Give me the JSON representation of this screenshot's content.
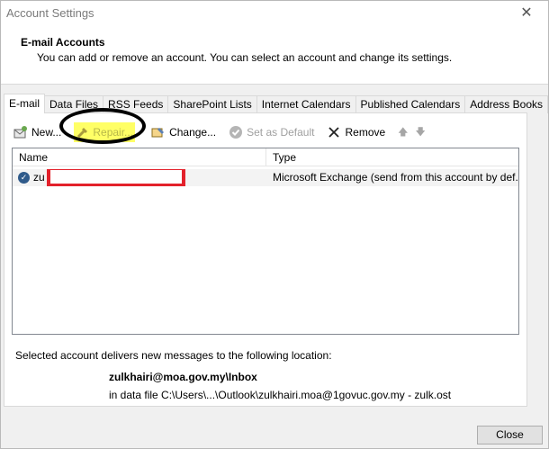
{
  "window": {
    "title": "Account Settings",
    "close_glyph": "✕"
  },
  "header": {
    "title": "E-mail Accounts",
    "subtitle": "You can add or remove an account. You can select an account and change its settings."
  },
  "tabs": [
    {
      "label": "E-mail",
      "active": true
    },
    {
      "label": "Data Files"
    },
    {
      "label": "RSS Feeds"
    },
    {
      "label": "SharePoint Lists"
    },
    {
      "label": "Internet Calendars"
    },
    {
      "label": "Published Calendars"
    },
    {
      "label": "Address Books"
    }
  ],
  "toolbar": {
    "new_label": "New...",
    "repair_label": "Repair...",
    "change_label": "Change...",
    "set_default_label": "Set as Default",
    "remove_label": "Remove",
    "up_glyph": "🡅",
    "down_glyph": "🡇",
    "highlight_color": "#ffff66",
    "annotation_color": "#000000"
  },
  "list": {
    "columns": {
      "name": "Name",
      "type": "Type"
    },
    "rows": [
      {
        "name": "zu",
        "type": "Microsoft Exchange (send from this account by def..."
      }
    ],
    "redaction_color": "#e3212b"
  },
  "delivery": {
    "label": "Selected account delivers new messages to the following location:",
    "account": "zulkhairi@moa.gov.my\\Inbox",
    "file": "in data file C:\\Users\\...\\Outlook\\zulkhairi.moa@1govuc.gov.my - zulk.ost"
  },
  "footer": {
    "close_label": "Close"
  }
}
